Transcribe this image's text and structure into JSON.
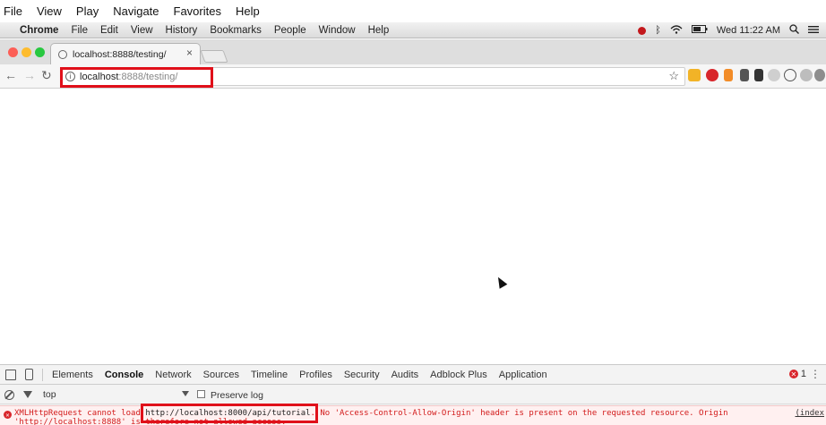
{
  "outer_menu": [
    "File",
    "View",
    "Play",
    "Navigate",
    "Favorites",
    "Help"
  ],
  "mac_menu": {
    "app_name": "Chrome",
    "items": [
      "File",
      "Edit",
      "View",
      "History",
      "Bookmarks",
      "People",
      "Window",
      "Help"
    ],
    "clock": "Wed 11:22 AM"
  },
  "tab": {
    "title": "localhost:8888/testing/",
    "close": "×"
  },
  "toolbar": {
    "back": "←",
    "forward": "→",
    "reload": "↻",
    "url_host": "localhost",
    "url_rest": ":8888/testing/",
    "star": "☆"
  },
  "devtools": {
    "tabs": [
      "Elements",
      "Console",
      "Network",
      "Sources",
      "Timeline",
      "Profiles",
      "Security",
      "Audits",
      "Adblock Plus",
      "Application"
    ],
    "active_tab": "Console",
    "error_count": "1",
    "context": "top",
    "preserve_log": "Preserve log",
    "console_line1_a": "XMLHttpRequest cannot load ",
    "console_url": "http://localhost:8000/api/tutorial",
    "console_line1_b": ". No 'Access-Control-Allow-Origin' header is present on the requested resource. Origin",
    "console_line2": "'http://localhost:8888' is therefore not allowed access.",
    "source_link": "(index"
  },
  "colors": {
    "highlight": "#e0101a",
    "error_text": "#d21a1a",
    "error_bg": "#fff0f0"
  }
}
